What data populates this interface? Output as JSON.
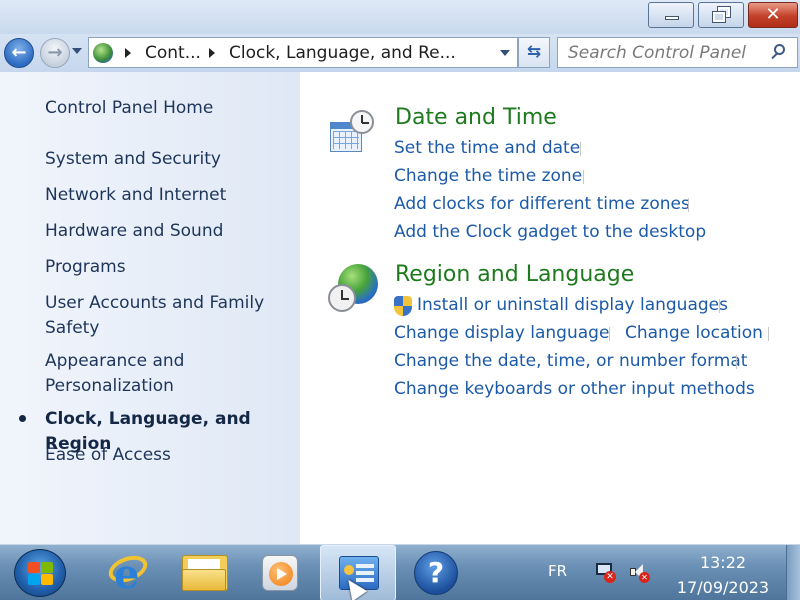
{
  "window": {
    "controls": {
      "minimize": "minimize",
      "maximize": "restore-down",
      "close": "✕"
    }
  },
  "address_bar": {
    "breadcrumbs": [
      "Cont...",
      "Clock, Language, and Re..."
    ],
    "icon": "control-panel-globe-icon"
  },
  "search": {
    "placeholder": "Search Control Panel"
  },
  "sidebar": {
    "items": [
      {
        "label": "Control Panel Home"
      },
      {
        "label": "System and Security"
      },
      {
        "label": "Network and Internet"
      },
      {
        "label": "Hardware and Sound"
      },
      {
        "label": "Programs"
      },
      {
        "label": "User Accounts and Family Safety"
      },
      {
        "label": "Appearance and Personalization"
      },
      {
        "label": "Clock, Language, and Region",
        "current": true
      },
      {
        "label": "Ease of Access"
      }
    ]
  },
  "categories": [
    {
      "title": "Date and Time",
      "tasks": [
        "Set the time and date",
        "Change the time zone",
        "Add clocks for different time zones",
        "Add the Clock gadget to the desktop"
      ]
    },
    {
      "title": "Region and Language",
      "tasks": [
        "Install or uninstall display languages",
        "Change display language",
        "Change location",
        "Change the date, time, or number format",
        "Change keyboards or other input methods"
      ]
    }
  ],
  "taskbar": {
    "pinned": [
      "internet-explorer-icon",
      "windows-explorer-icon",
      "media-player-icon",
      "control-panel-icon",
      "help-icon"
    ],
    "active": "control-panel-icon",
    "language": "FR",
    "time": "13:22",
    "date": "17/09/2023"
  },
  "colors": {
    "category_title": "#1e7a1e",
    "task_link": "#1c5aa8",
    "sidebar_text": "#1e3559"
  }
}
